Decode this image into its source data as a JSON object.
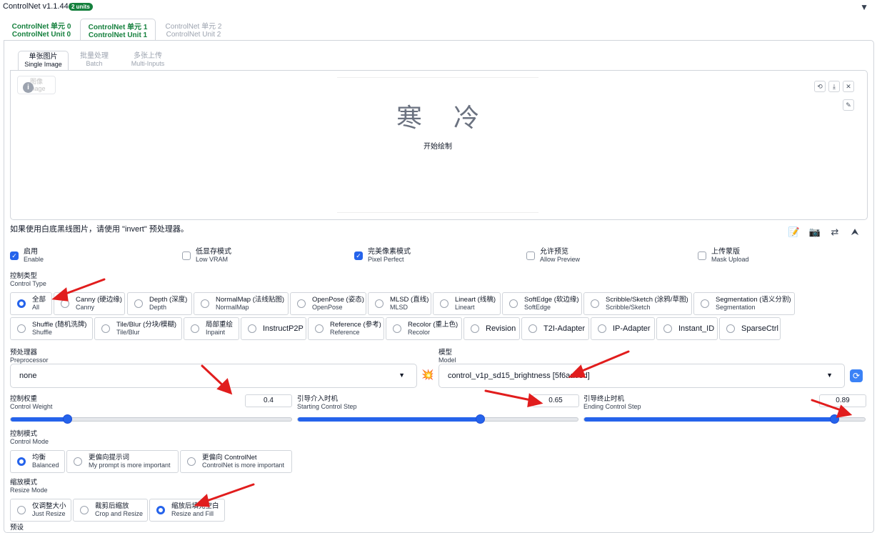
{
  "header": {
    "title": "ControlNet v1.1.441",
    "units_badge": "2 units",
    "collapse_icon": "triangle-down-icon"
  },
  "unit_tabs": [
    {
      "l1": "ControlNet 单元 0",
      "l2": "ControlNet Unit 0"
    },
    {
      "l1": "ControlNet 单元 1",
      "l2": "ControlNet Unit 1"
    },
    {
      "l1": "ControlNet 单元 2",
      "l2": "ControlNet Unit 2"
    }
  ],
  "input_tabs": [
    {
      "l1": "单张图片",
      "l2": "Single Image"
    },
    {
      "l1": "批量处理",
      "l2": "Batch"
    },
    {
      "l1": "多张上传",
      "l2": "Multi-Inputs"
    }
  ],
  "image_panel": {
    "label_l1": "图像",
    "label_l2": "Image",
    "canvas_title": "寒冷",
    "canvas_hint": "开始绘制"
  },
  "invert_hint": "如果使用白底黑线图片，请使用 \"invert\" 预处理器。",
  "options": [
    {
      "l1": "启用",
      "l2": "Enable",
      "checked": true
    },
    {
      "l1": "低显存模式",
      "l2": "Low VRAM",
      "checked": false
    },
    {
      "l1": "完美像素模式",
      "l2": "Pixel Perfect",
      "checked": true
    },
    {
      "l1": "允许预览",
      "l2": "Allow Preview",
      "checked": false
    },
    {
      "l1": "上传蒙版",
      "l2": "Mask Upload",
      "checked": false
    }
  ],
  "control_type": {
    "label_l1": "控制类型",
    "label_l2": "Control Type",
    "row1": [
      {
        "l1": "全部",
        "l2": "All",
        "selected": true
      },
      {
        "l1": "Canny (硬边缘)",
        "l2": "Canny"
      },
      {
        "l1": "Depth (深度)",
        "l2": "Depth"
      },
      {
        "l1": "NormalMap (法线贴图)",
        "l2": "NormalMap"
      },
      {
        "l1": "OpenPose (姿态)",
        "l2": "OpenPose"
      },
      {
        "l1": "MLSD (直线)",
        "l2": "MLSD"
      },
      {
        "l1": "Lineart (线稿)",
        "l2": "Lineart"
      },
      {
        "l1": "SoftEdge (软边缘)",
        "l2": "SoftEdge"
      },
      {
        "l1": "Scribble/Sketch (涂鸦/草图)",
        "l2": "Scribble/Sketch"
      },
      {
        "l1": "Segmentation (语义分割)",
        "l2": "Segmentation"
      }
    ],
    "row2": [
      {
        "l1": "Shuffle (随机洗牌)",
        "l2": "Shuffle"
      },
      {
        "l1": "Tile/Blur (分块/模糊)",
        "l2": "Tile/Blur"
      },
      {
        "l1": "局部重绘",
        "l2": "Inpaint"
      },
      {
        "l1": "InstructP2P",
        "l2": ""
      },
      {
        "l1": "Reference (参考)",
        "l2": "Reference"
      },
      {
        "l1": "Recolor (重上色)",
        "l2": "Recolor"
      },
      {
        "l1": "Revision",
        "l2": ""
      },
      {
        "l1": "T2I-Adapter",
        "l2": ""
      },
      {
        "l1": "IP-Adapter",
        "l2": ""
      },
      {
        "l1": "Instant_ID",
        "l2": ""
      },
      {
        "l1": "SparseCtrl",
        "l2": ""
      }
    ]
  },
  "preprocessor": {
    "label_l1": "预处理器",
    "label_l2": "Preprocessor",
    "value": "none",
    "run_icon": "explosion-icon"
  },
  "model": {
    "label_l1": "模型",
    "label_l2": "Model",
    "value": "control_v1p_sd15_brightness [5f6aa6ed]",
    "refresh_icon": "refresh-icon"
  },
  "sliders": [
    {
      "l1": "控制权重",
      "l2": "Control Weight",
      "value": "0.4",
      "fraction": 0.2
    },
    {
      "l1": "引导介入时机",
      "l2": "Starting Control Step",
      "value": "0.65",
      "fraction": 0.65
    },
    {
      "l1": "引导终止时机",
      "l2": "Ending Control Step",
      "value": "0.89",
      "fraction": 0.89
    }
  ],
  "control_mode": {
    "label_l1": "控制模式",
    "label_l2": "Control Mode",
    "options": [
      {
        "l1": "均衡",
        "l2": "Balanced",
        "selected": true
      },
      {
        "l1": "更偏向提示词",
        "l2": "My prompt is more important"
      },
      {
        "l1": "更偏向 ControlNet",
        "l2": "ControlNet is more important"
      }
    ]
  },
  "resize_mode": {
    "label_l1": "缩放模式",
    "label_l2": "Resize Mode",
    "options": [
      {
        "l1": "仅调整大小",
        "l2": "Just Resize"
      },
      {
        "l1": "裁剪后缩放",
        "l2": "Crop and Resize"
      },
      {
        "l1": "缩放后填充空白",
        "l2": "Resize and Fill",
        "selected": true
      }
    ]
  },
  "preset": {
    "label_l1": "预设"
  },
  "colors": {
    "accent": "#2563eb",
    "tab_active": "#15803d",
    "annotation_arrow": "#e11d1d"
  }
}
